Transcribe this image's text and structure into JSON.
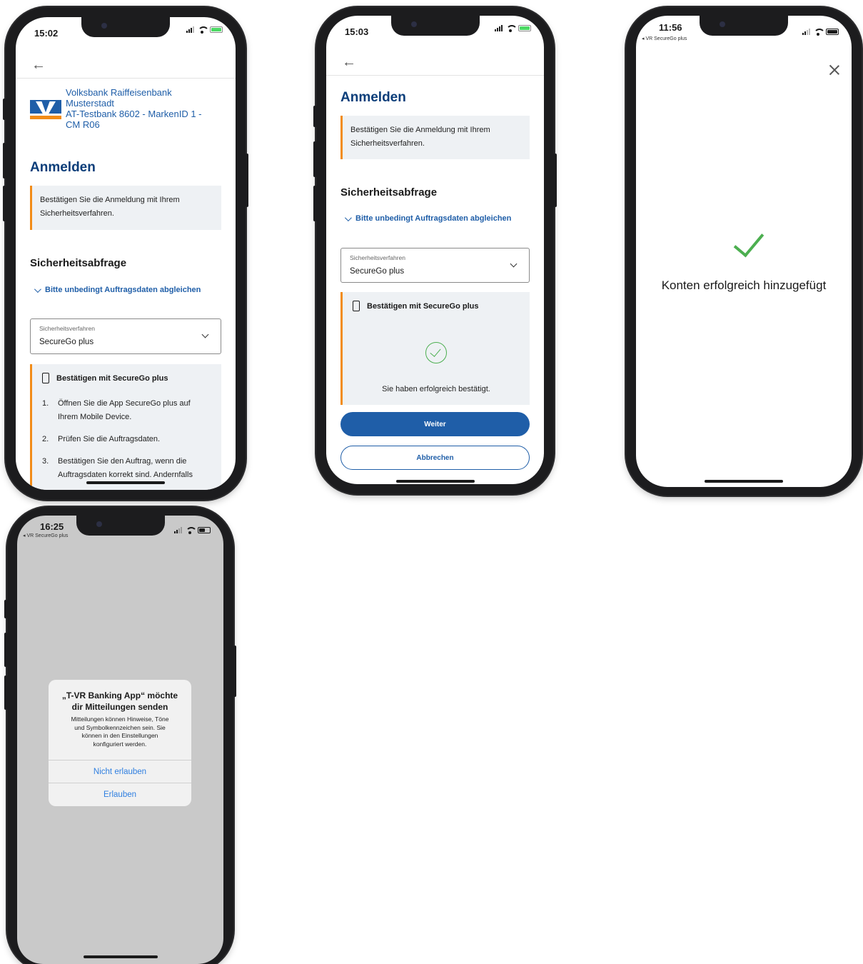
{
  "colors": {
    "brand_blue": "#1f5ea8",
    "title_blue": "#0b3d79",
    "accent_orange": "#f28c18",
    "success_green": "#4caf50",
    "info_bg": "#eef1f4",
    "ios_link": "#2f7fe0"
  },
  "phone1": {
    "time": "15:02",
    "back_icon": "arrow-left-icon",
    "bank": {
      "line1": "Volksbank Raiffeisenbank",
      "line2": "Musterstadt",
      "line3": "AT-Testbank 8602 - MarkenID 1 -",
      "line4": "CM R06"
    },
    "title": "Anmelden",
    "info_line1": "Bestätigen Sie die Anmeldung mit Ihrem",
    "info_line2": "Sicherheitsverfahren.",
    "section_title": "Sicherheitsabfrage",
    "link_text": "Bitte unbedingt Auftragsdaten abgleichen",
    "select_label": "Sicherheitsverfahren",
    "select_value": "SecureGo plus",
    "confirm_title": "Bestätigen mit SecureGo plus",
    "steps": [
      {
        "num": "1.",
        "line1": "Öffnen Sie die App SecureGo plus auf",
        "line2": "Ihrem Mobile Device."
      },
      {
        "num": "2.",
        "line1": "Prüfen Sie die Auftragsdaten.",
        "line2": ""
      },
      {
        "num": "3.",
        "line1": "Bestätigen Sie den Auftrag, wenn die",
        "line2": "Auftragsdaten korrekt sind. Andernfalls"
      }
    ]
  },
  "phone2": {
    "time": "15:03",
    "back_icon": "arrow-left-icon",
    "title": "Anmelden",
    "info_line1": "Bestätigen Sie die Anmeldung mit Ihrem",
    "info_line2": "Sicherheitsverfahren.",
    "section_title": "Sicherheitsabfrage",
    "link_text": "Bitte unbedingt Auftragsdaten abgleichen",
    "select_label": "Sicherheitsverfahren",
    "select_value": "SecureGo plus",
    "confirm_title": "Bestätigen mit SecureGo plus",
    "success_text": "Sie haben erfolgreich bestätigt.",
    "primary_button": "Weiter",
    "secondary_button": "Abbrechen"
  },
  "phone3": {
    "time": "11:56",
    "back_app": "◂ VR SecureGo plus",
    "close_icon": "close-icon",
    "message": "Konten erfolgreich hinzugefügt"
  },
  "phone4": {
    "time": "16:25",
    "back_app": "◂ VR SecureGo plus",
    "alert_title_line1": "„T-VR Banking App“ möchte",
    "alert_title_line2": "dir Mitteilungen senden",
    "alert_msg_line1": "Mitteilungen können Hinweise, Töne",
    "alert_msg_line2": "und Symbolkennzeichen sein. Sie",
    "alert_msg_line3": "können in den Einstellungen",
    "alert_msg_line4": "konfiguriert werden.",
    "deny_button": "Nicht erlauben",
    "allow_button": "Erlauben"
  }
}
